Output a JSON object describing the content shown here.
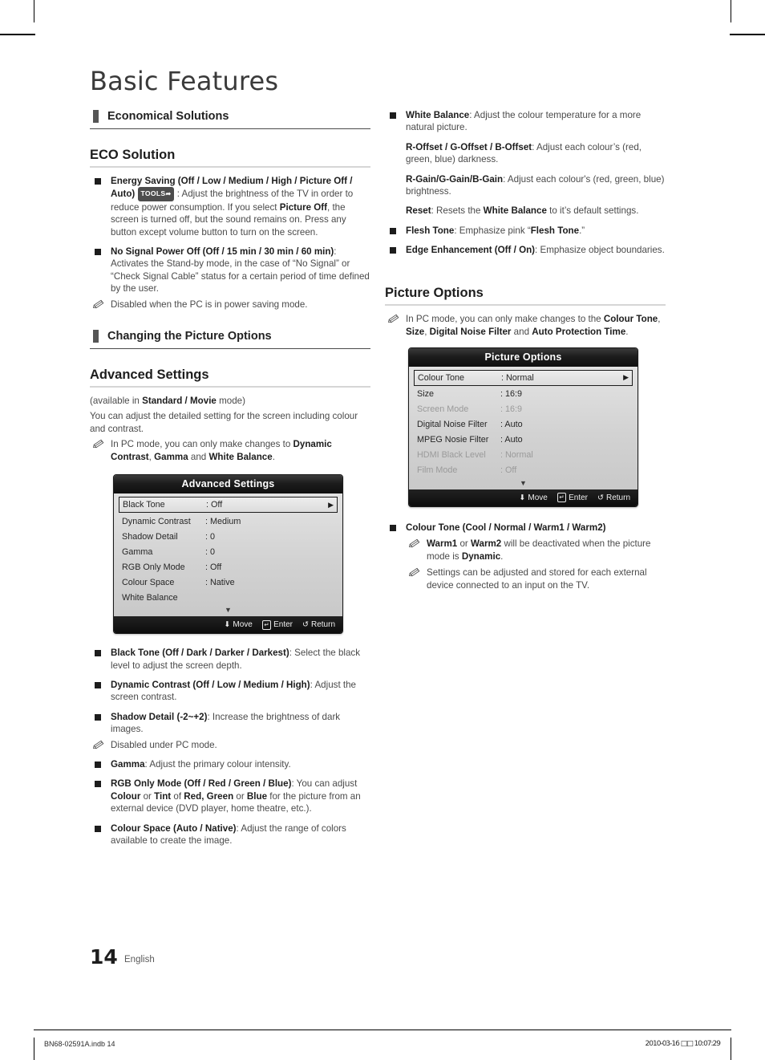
{
  "page": {
    "title": "Basic Features",
    "number": "14",
    "language": "English",
    "imprint_left": "BN68-02591A.indb   14",
    "imprint_right": "2010-03-16   □□ 10:07:29"
  },
  "left_column": {
    "section_1": {
      "heading": "Economical Solutions",
      "sub_heading": "ECO Solution",
      "bullets": [
        {
          "title": "Energy Saving (Off / Low / Medium / High / Picture Off / Auto)",
          "badge": "TOOLS",
          "body_1": ": Adjust the brightness of the TV in order to reduce power consumption. If you select ",
          "bold_mid": "Picture Off",
          "body_2": ", the screen is turned off, but the sound remains on. Press any button except volume button to turn on the screen."
        },
        {
          "title": "No Signal Power Off (Off / 15 min / 30 min / 60 min)",
          "body": ": Activates the Stand-by mode, in the case of “No Signal” or “Check Signal Cable” status for a certain period of time defined by the user.",
          "note": "Disabled when the PC is in power saving mode."
        }
      ]
    },
    "section_2": {
      "heading": "Changing the Picture Options",
      "sub_heading": "Advanced Settings",
      "intro_pre": "(available in ",
      "intro_bold": "Standard / Movie",
      "intro_post": " mode)",
      "intro_2": "You can adjust the detailed setting for the screen including colour and contrast.",
      "note_pre": "In PC mode, you can only make changes to ",
      "note_b1": "Dynamic Contrast",
      "note_mid": ", ",
      "note_b2": "Gamma",
      "note_and": " and ",
      "note_b3": "White Balance",
      "note_end": "."
    },
    "osd_advanced": {
      "title": "Advanced Settings",
      "rows": [
        {
          "key": "Black Tone",
          "value": ": Off",
          "selected": true,
          "dim": false,
          "arrow": "▶"
        },
        {
          "key": "Dynamic Contrast",
          "value": ": Medium",
          "selected": false,
          "dim": false,
          "arrow": ""
        },
        {
          "key": "Shadow Detail",
          "value": ": 0",
          "selected": false,
          "dim": false,
          "arrow": ""
        },
        {
          "key": "Gamma",
          "value": ": 0",
          "selected": false,
          "dim": false,
          "arrow": ""
        },
        {
          "key": "RGB Only Mode",
          "value": ": Off",
          "selected": false,
          "dim": false,
          "arrow": ""
        },
        {
          "key": "Colour Space",
          "value": ": Native",
          "selected": false,
          "dim": false,
          "arrow": ""
        },
        {
          "key": "White Balance",
          "value": "",
          "selected": false,
          "dim": false,
          "arrow": ""
        }
      ],
      "scroll_down": "▼",
      "footer": {
        "move": "Move",
        "enter": "Enter",
        "return": "Return"
      }
    },
    "bullets_after": [
      {
        "title": "Black Tone (Off / Dark / Darker / Darkest)",
        "body": ": Select the black level to adjust the screen depth."
      },
      {
        "title": "Dynamic Contrast (Off / Low / Medium / High)",
        "body": ": Adjust the screen contrast."
      },
      {
        "title": "Shadow Detail (-2~+2)",
        "body": ": Increase the brightness of dark images.",
        "note": "Disabled under PC mode."
      },
      {
        "title": "Gamma",
        "body": ": Adjust the primary colour intensity."
      },
      {
        "title": "RGB Only Mode (Off / Red / Green / Blue)",
        "body": ": You can adjust Colour or Tint of Red, Green or Blue for the picture from an external device (DVD player, home theatre, etc.)."
      },
      {
        "title": "Colour Space (Auto / Native)",
        "body": ": Adjust the range of colors available to create the image."
      }
    ]
  },
  "right_column": {
    "bullets_top": [
      {
        "title": "White Balance",
        "body": ": Adjust the colour temperature for a more natural picture.",
        "sub_items": [
          {
            "title": "R-Offset / G-Offset / B-Offset",
            "body": ": Adjust each colour’s (red, green, blue) darkness."
          },
          {
            "title": "R-Gain/G-Gain/B-Gain",
            "body": ": Adjust each colour's (red, green, blue) brightness."
          },
          {
            "title": "Reset",
            "body_pre": ": Resets the ",
            "body_bold": "White Balance",
            "body_post": " to it’s default settings."
          }
        ]
      },
      {
        "title": "Flesh Tone",
        "body_pre": ": Emphasize pink “",
        "body_bold": "Flesh Tone",
        "body_post": ".”"
      },
      {
        "title": "Edge Enhancement (Off / On)",
        "body": ": Emphasize object boundaries."
      }
    ],
    "section": {
      "sub_heading": "Picture Options",
      "note_pre": "In PC mode, you can only make changes to the ",
      "note_b1": "Colour Tone",
      "note_sep1": ", ",
      "note_b2": "Size",
      "note_sep2": ", ",
      "note_b3": "Digital Noise Filter",
      "note_and": " and ",
      "note_b4": "Auto Protection Time",
      "note_end": "."
    },
    "osd_picture": {
      "title": "Picture Options",
      "rows": [
        {
          "key": "Colour Tone",
          "value": ": Normal",
          "selected": true,
          "dim": false,
          "arrow": "▶"
        },
        {
          "key": "Size",
          "value": ": 16:9",
          "selected": false,
          "dim": false,
          "arrow": ""
        },
        {
          "key": "Screen Mode",
          "value": ": 16:9",
          "selected": false,
          "dim": true,
          "arrow": ""
        },
        {
          "key": "Digital Noise Filter",
          "value": ": Auto",
          "selected": false,
          "dim": false,
          "arrow": ""
        },
        {
          "key": "MPEG Nosie Filter",
          "value": ": Auto",
          "selected": false,
          "dim": false,
          "arrow": ""
        },
        {
          "key": "HDMI Black Level",
          "value": ": Normal",
          "selected": false,
          "dim": true,
          "arrow": ""
        },
        {
          "key": "Film Mode",
          "value": ": Off",
          "selected": false,
          "dim": true,
          "arrow": ""
        }
      ],
      "scroll_down": "▼",
      "footer": {
        "move": "Move",
        "enter": "Enter",
        "return": "Return"
      }
    },
    "bullets_bottom": [
      {
        "title": "Colour Tone (Cool / Normal / Warm1 / Warm2)",
        "notes": [
          {
            "b1": "Warm1",
            "mid": " or ",
            "b2": "Warm2",
            "tail_pre": " will be deactivated when the picture mode is ",
            "b3": "Dynamic",
            "tail_post": "."
          },
          {
            "plain": "Settings can be adjusted and stored for each external device connected to an input on the TV."
          }
        ]
      }
    ]
  },
  "icons": {
    "pencil": "pencil-note-icon",
    "arrow_right": "▶",
    "updown": "↕",
    "return": "↺"
  }
}
